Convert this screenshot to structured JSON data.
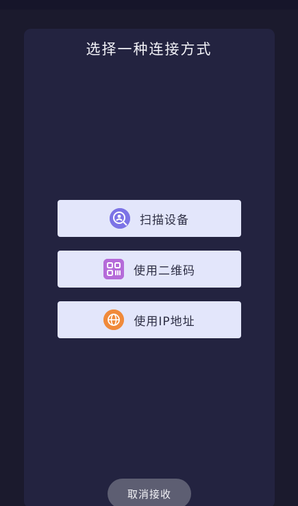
{
  "dialog": {
    "title": "选择一种连接方式",
    "options": [
      {
        "label": "扫描设备",
        "icon": "scan-device-icon",
        "color": "#7c73e6"
      },
      {
        "label": "使用二维码",
        "icon": "qr-code-icon",
        "color": "#b56bd9"
      },
      {
        "label": "使用IP地址",
        "icon": "globe-icon",
        "color": "#f08a3b"
      }
    ],
    "cancel_label": "取消接收"
  },
  "colors": {
    "background": "#1b1a2d",
    "panel": "#232340",
    "option_bg": "#e3e6fb",
    "cancel_bg": "#5d5e72"
  }
}
